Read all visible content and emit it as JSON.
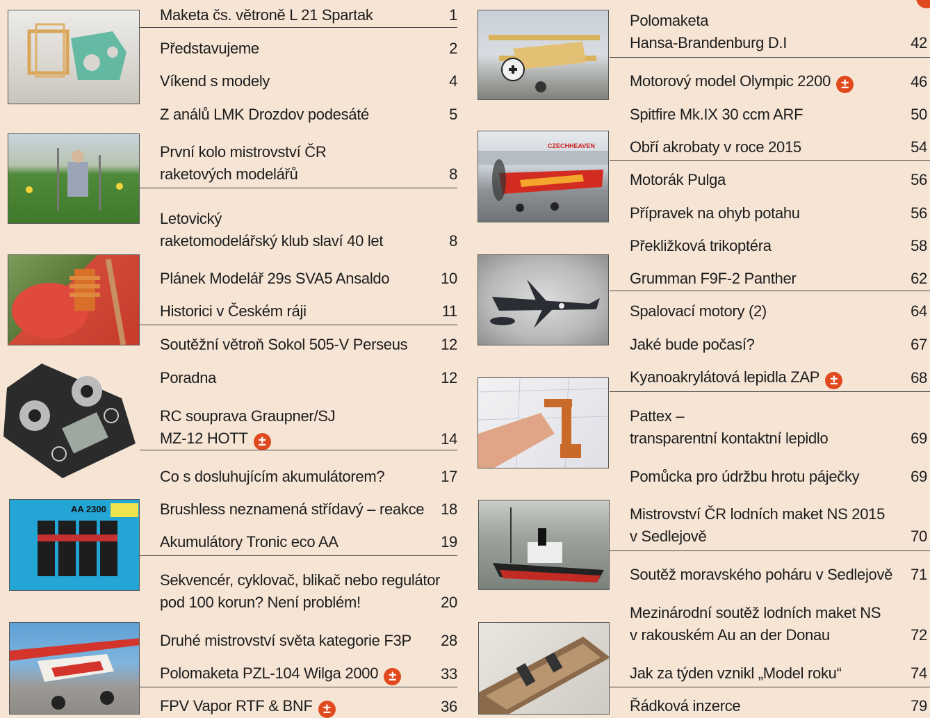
{
  "plus_icon_text": "±",
  "left": [
    {
      "title": "Maketa čs. větroně L 21 Spartak",
      "page": "1"
    },
    {
      "title": "Představujeme",
      "page": "2"
    },
    {
      "title": "Víkend s modely",
      "page": "4"
    },
    {
      "title": "Z análů LMK Drozdov podesáté",
      "page": "5"
    },
    {
      "title": "První kolo mistrovství ČR",
      "title2": "raketových modelářů",
      "page": "8"
    },
    {
      "title": "Letovický",
      "title2": "raketomodelářský klub slaví 40 let",
      "page": "8"
    },
    {
      "title": "Plánek Modelář 29s SVA5 Ansaldo",
      "page": "10"
    },
    {
      "title": "Historici v Českém ráji",
      "page": "11"
    },
    {
      "title": "Soutěžní větroň Sokol 505-V Perseus",
      "page": "12"
    },
    {
      "title": "Poradna",
      "page": "12"
    },
    {
      "title": "RC souprava Graupner/SJ",
      "title2": "MZ-12 HOTT",
      "page": "14"
    },
    {
      "title": "Co s dosluhujícím akumulátorem?",
      "page": "17"
    },
    {
      "title": "Brushless neznamená střídavý – reakce",
      "page": "18"
    },
    {
      "title": "Akumulátory Tronic eco AA",
      "page": "19"
    },
    {
      "title": "Sekvencér, cyklovač, blikač nebo regulátor",
      "title2": "pod 100 korun? Není problém!",
      "page": "20"
    },
    {
      "title": "Druhé mistrovství světa kategorie F3P",
      "page": "28"
    },
    {
      "title": "Polomaketa PZL-104 Wilga 2000",
      "page": "33"
    },
    {
      "title": "FPV Vapor RTF & BNF",
      "page": "36"
    }
  ],
  "right": [
    {
      "title": "Polomaketa",
      "title2": "Hansa-Brandenburg D.I",
      "page": "42"
    },
    {
      "title": "Motorový model Olympic 2200",
      "page": "46"
    },
    {
      "title": "Spitfire Mk.IX 30 ccm ARF",
      "page": "50"
    },
    {
      "title": "Obří akrobaty v roce 2015",
      "page": "54"
    },
    {
      "title": "Motorák Pulga",
      "page": "56"
    },
    {
      "title": "Přípravek na ohyb potahu",
      "page": "56"
    },
    {
      "title": "Překližková trikoptéra",
      "page": "58"
    },
    {
      "title": "Grumman F9F-2 Panther",
      "page": "62"
    },
    {
      "title": "Spalovací motory (2)",
      "page": "64"
    },
    {
      "title": "Jaké bude počasí?",
      "page": "67"
    },
    {
      "title": "Kyanoakrylátová lepidla ZAP",
      "page": "68"
    },
    {
      "title": "Pattex –",
      "title2": "transparentní kontaktní lepidlo",
      "page": "69"
    },
    {
      "title": "Pomůcka pro údržbu hrotu páječky",
      "page": "69"
    },
    {
      "title": "Mistrovství ČR lodních maket NS 2015",
      "title2": "v Sedlejově",
      "page": "70"
    },
    {
      "title": "Soutěž moravského poháru v Sedlejově",
      "page": "71"
    },
    {
      "title": "Mezinárodní soutěž lodních maket NS",
      "title2": "v rakouském Au an der Donau",
      "page": "72"
    },
    {
      "title": "Jak za týden vznikl „Model roku“",
      "page": "74"
    },
    {
      "title": "Řádková inzerce",
      "page": "79"
    }
  ],
  "photos_text": {
    "banner": "CZECHHEAVEN",
    "battery": "AA 2300"
  }
}
